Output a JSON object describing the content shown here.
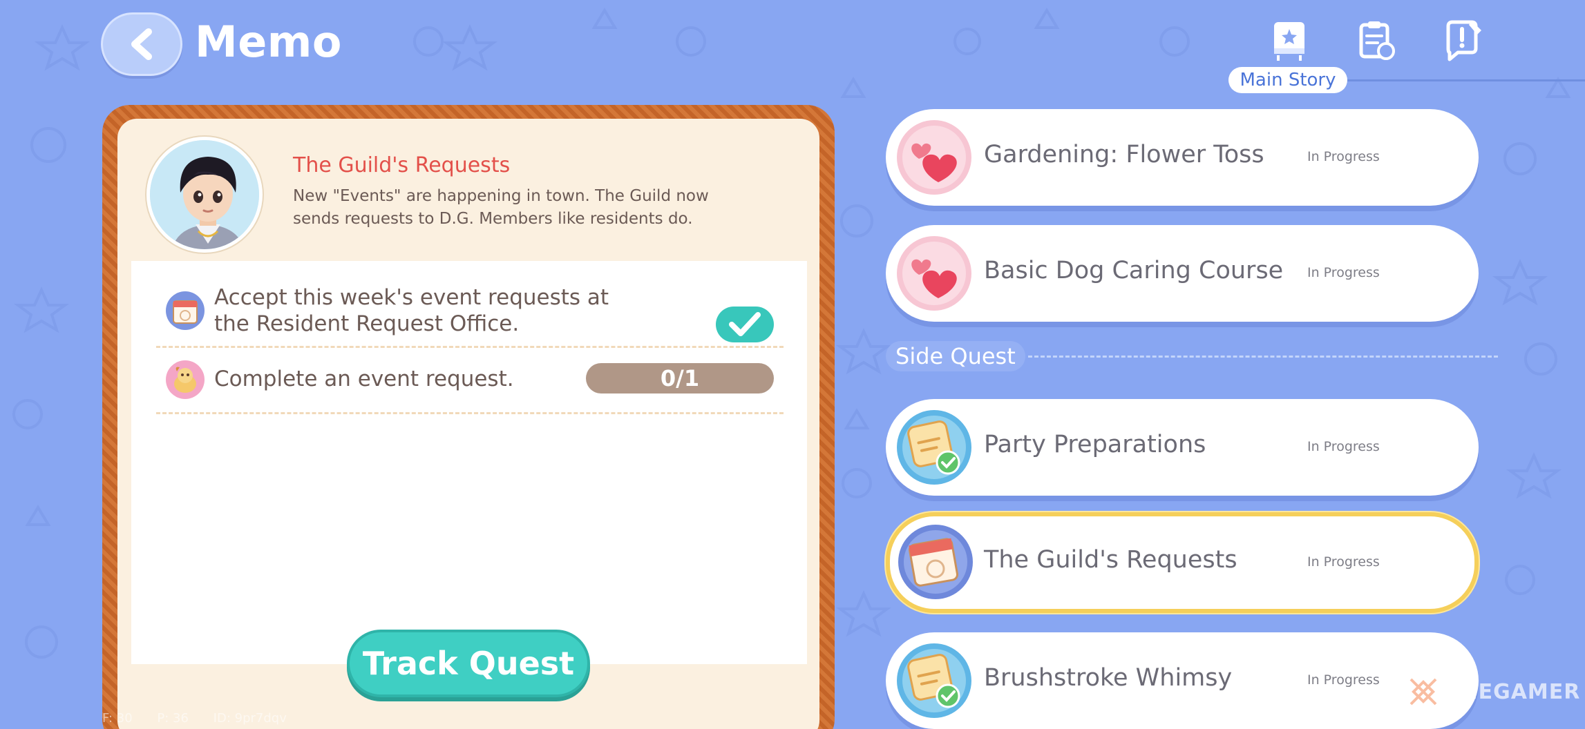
{
  "header": {
    "title": "Memo",
    "active_tab_label": "Main Story"
  },
  "detail": {
    "quest_title": "The Guild's Requests",
    "description": "New \"Events\" are happening in town. The Guild now sends requests to D.G. Members like residents do.",
    "tasks": [
      {
        "line1": "Accept this week's event requests at",
        "line2": "the Resident Request Office.",
        "completed": true
      },
      {
        "line1": "Complete an event request.",
        "progress": "0/1"
      }
    ],
    "track_button": "Track Quest"
  },
  "debug": {
    "f": "F: 30",
    "p": "P: 36",
    "id": "ID: 9pr7dqv"
  },
  "main_story": [
    {
      "name": "Gardening: Flower Toss",
      "status": "In Progress",
      "icon": "hearts-icon"
    },
    {
      "name": "Basic Dog Caring Course",
      "status": "In Progress",
      "icon": "hearts-icon"
    }
  ],
  "side_quest_label": "Side Quest",
  "side_quests": [
    {
      "name": "Party Preparations",
      "status": "In Progress",
      "icon": "memo-check-icon"
    },
    {
      "name": "The Guild's Requests",
      "status": "In Progress",
      "icon": "calendar-icon",
      "selected": true
    },
    {
      "name": "Brushstroke Whimsy",
      "status": "In Progress",
      "icon": "memo-check-icon"
    }
  ],
  "watermark": "THEGAMER",
  "colors": {
    "background": "#88a6f2",
    "accent_title": "#e3504a",
    "teal": "#3fcfc3",
    "selected_border": "#f5cf5a"
  }
}
